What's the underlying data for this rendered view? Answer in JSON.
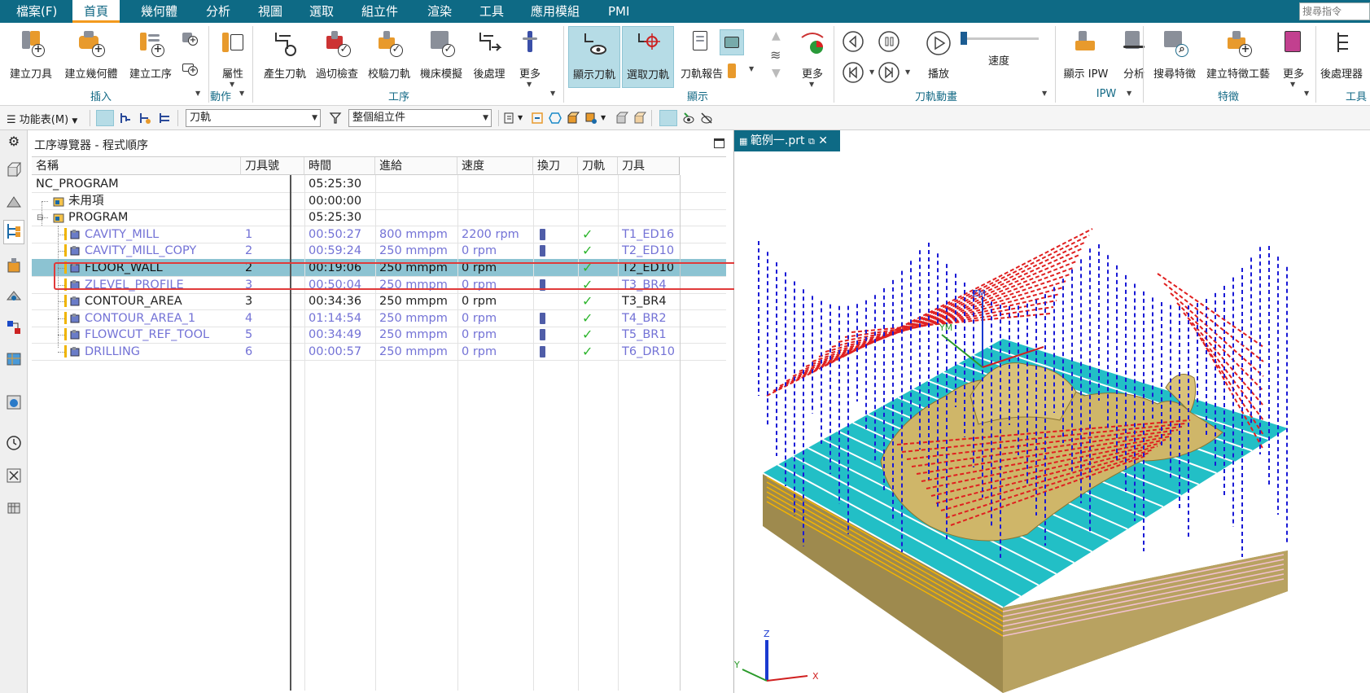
{
  "menubar": {
    "items": [
      "檔案(F)",
      "首頁",
      "幾何體",
      "分析",
      "視圖",
      "選取",
      "組立件",
      "渲染",
      "工具",
      "應用模組",
      "PMI"
    ],
    "active": "首頁",
    "search_placeholder": "搜尋指令"
  },
  "ribbon": {
    "buttons": {
      "create_tool": "建立刀具",
      "create_geometry": "建立幾何體",
      "create_operation": "建立工序",
      "properties": "屬性",
      "generate_path": "產生刀軌",
      "gouge_check": "過切檢查",
      "verify_path": "校驗刀軌",
      "machine_sim": "機床模擬",
      "postprocess": "後處理",
      "more_ops": "更多",
      "show_path": "顯示刀軌",
      "select_path": "選取刀軌",
      "path_report": "刀軌報告",
      "more_display": "更多",
      "play": "播放",
      "speed": "速度",
      "show_ipw": "顯示 IPW",
      "analyze": "分析",
      "find_feature": "搜尋特徵",
      "create_feature_op": "建立特徵工藝",
      "more_feature": "更多",
      "postprocess_cut": "後處理器"
    },
    "groups": {
      "insert": "插入",
      "action": "動作",
      "operation": "工序",
      "display": "顯示",
      "animation": "刀軌動畫",
      "ipw": "IPW",
      "feature": "特徵",
      "tools": "工具"
    }
  },
  "toolbar": {
    "menu_label": "功能表(M)",
    "filter_value": "刀軌",
    "scope_value": "整個組立件"
  },
  "navigator": {
    "title": "工序導覽器 - 程式順序",
    "columns": [
      "名稱",
      "刀具號",
      "時間",
      "進給",
      "速度",
      "換刀",
      "刀軌",
      "刀具"
    ],
    "rows": [
      {
        "name": "NC_PROGRAM",
        "toolno": "",
        "time": "05:25:30",
        "feed": "",
        "speed": "",
        "toolchange": false,
        "path": false,
        "tool": "",
        "style": "normal",
        "level": 0
      },
      {
        "name": "未用項",
        "toolno": "",
        "time": "00:00:00",
        "feed": "",
        "speed": "",
        "toolchange": false,
        "path": false,
        "tool": "",
        "style": "normal",
        "level": 1
      },
      {
        "name": "PROGRAM",
        "toolno": "",
        "time": "05:25:30",
        "feed": "",
        "speed": "",
        "toolchange": false,
        "path": false,
        "tool": "",
        "style": "normal",
        "level": 1
      },
      {
        "name": "CAVITY_MILL",
        "toolno": "1",
        "time": "00:50:27",
        "feed": "800 mmpm",
        "speed": "2200 rpm",
        "toolchange": true,
        "path": true,
        "tool": "T1_ED16",
        "style": "dim",
        "level": 2
      },
      {
        "name": "CAVITY_MILL_COPY",
        "toolno": "2",
        "time": "00:59:24",
        "feed": "250 mmpm",
        "speed": "0 rpm",
        "toolchange": true,
        "path": true,
        "tool": "T2_ED10",
        "style": "dim",
        "level": 2
      },
      {
        "name": "FLOOR_WALL",
        "toolno": "2",
        "time": "00:19:06",
        "feed": "250 mmpm",
        "speed": "0 rpm",
        "toolchange": false,
        "path": true,
        "tool": "T2_ED10",
        "style": "sel",
        "level": 2
      },
      {
        "name": "ZLEVEL_PROFILE",
        "toolno": "3",
        "time": "00:50:04",
        "feed": "250 mmpm",
        "speed": "0 rpm",
        "toolchange": true,
        "path": true,
        "tool": "T3_BR4",
        "style": "dim",
        "level": 2
      },
      {
        "name": "CONTOUR_AREA",
        "toolno": "3",
        "time": "00:34:36",
        "feed": "250 mmpm",
        "speed": "0 rpm",
        "toolchange": false,
        "path": true,
        "tool": "T3_BR4",
        "style": "normal",
        "level": 2
      },
      {
        "name": "CONTOUR_AREA_1",
        "toolno": "4",
        "time": "01:14:54",
        "feed": "250 mmpm",
        "speed": "0 rpm",
        "toolchange": true,
        "path": true,
        "tool": "T4_BR2",
        "style": "dim",
        "level": 2
      },
      {
        "name": "FLOWCUT_REF_TOOL",
        "toolno": "5",
        "time": "00:34:49",
        "feed": "250 mmpm",
        "speed": "0 rpm",
        "toolchange": true,
        "path": true,
        "tool": "T5_BR1",
        "style": "dim",
        "level": 2
      },
      {
        "name": "DRILLING",
        "toolno": "6",
        "time": "00:00:57",
        "feed": "250 mmpm",
        "speed": "0 rpm",
        "toolchange": true,
        "path": true,
        "tool": "T6_DR10",
        "style": "dim",
        "level": 2
      }
    ]
  },
  "viewport": {
    "tab_label": "範例一.prt",
    "axis_labels": {
      "ym": "YM",
      "zm": "ZM",
      "x": "X",
      "y": "Y",
      "z": "Z"
    }
  },
  "colors": {
    "brand": "#0e6a85",
    "accent": "#f39a1e",
    "selection": "#8cc3d2",
    "highlight_box": "#e03a3a",
    "dim_text": "#7372d6",
    "path_red": "#e02020",
    "path_blue": "#1a1ad6",
    "floor_cyan": "#20c0c8",
    "stock_gold": "#b9a060"
  }
}
